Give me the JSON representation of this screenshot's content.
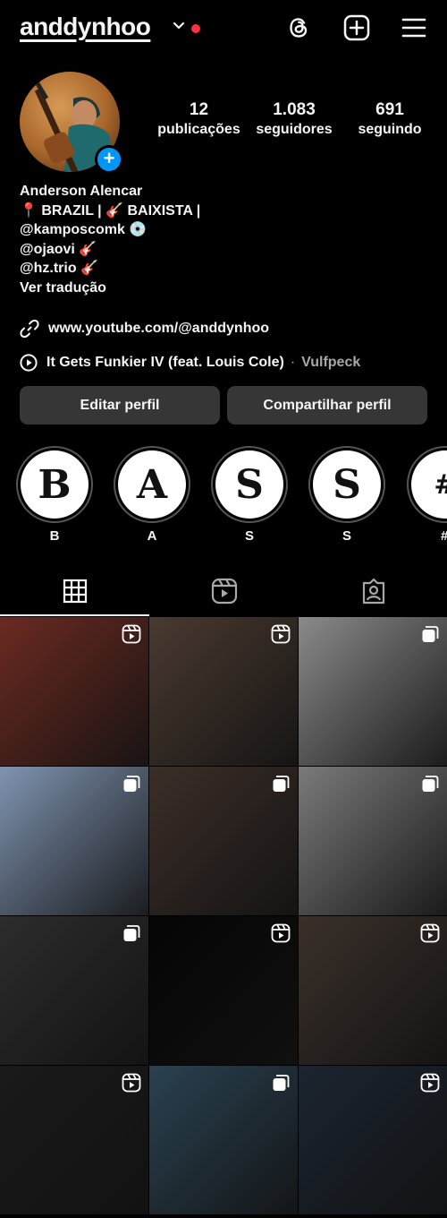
{
  "header": {
    "username": "anddynhoo"
  },
  "profile": {
    "stats": [
      {
        "value": "12",
        "label": "publicações"
      },
      {
        "value": "1.083",
        "label": "seguidores"
      },
      {
        "value": "691",
        "label": "seguindo"
      }
    ],
    "bio_lines": [
      "Anderson Alencar",
      "📍 BRAZIL | 🎸 BAIXISTA |",
      "@kamposcomk 💿",
      "@ojaovi 🎸",
      "@hz.trio 🎸",
      "Ver tradução"
    ],
    "link": "www.youtube.com/@anddynhoo",
    "music": {
      "song": "It Gets Funkier IV (feat. Louis Cole)",
      "separator": "·",
      "artist": "Vulfpeck"
    }
  },
  "buttons": {
    "edit": "Editar perfil",
    "share": "Compartilhar perfil"
  },
  "highlights": [
    {
      "letter": "B",
      "label": "B"
    },
    {
      "letter": "A",
      "label": "A"
    },
    {
      "letter": "S",
      "label": "S"
    },
    {
      "letter": "S",
      "label": "S"
    },
    {
      "letter": "#",
      "label": "#"
    }
  ],
  "tabs": [
    "posts-grid",
    "reels",
    "tagged"
  ],
  "grid_posts": [
    {
      "type": "reel",
      "bg": "#6b2a22"
    },
    {
      "type": "reel",
      "bg": "#4a3a30"
    },
    {
      "type": "multi",
      "bg": "#8a8a8a"
    },
    {
      "type": "multi",
      "bg": "#7f93b0"
    },
    {
      "type": "multi",
      "bg": "#3b2e28"
    },
    {
      "type": "multi",
      "bg": "#7a7a7a"
    },
    {
      "type": "multi",
      "bg": "#2c2c2c"
    },
    {
      "type": "reel",
      "bg": "#050505"
    },
    {
      "type": "reel",
      "bg": "#3a302a"
    },
    {
      "type": "reel",
      "bg": "#1a1a1a"
    },
    {
      "type": "multi",
      "bg": "#2a4150"
    },
    {
      "type": "reel",
      "bg": "#1b2430"
    }
  ]
}
